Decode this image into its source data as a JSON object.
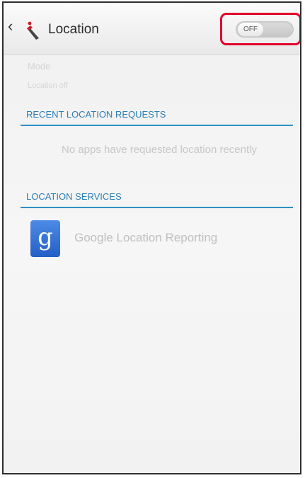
{
  "header": {
    "back_glyph": "‹",
    "title": "Location",
    "app_icon": "location-app-icon"
  },
  "toggle": {
    "label": "OFF",
    "state": "off",
    "highlight_color": "#e0002a"
  },
  "mode": {
    "title": "Mode",
    "value": "Location off"
  },
  "sections": {
    "recent_requests": {
      "header": "RECENT LOCATION REQUESTS",
      "empty_message": "No apps have requested location recently"
    },
    "location_services": {
      "header": "LOCATION SERVICES",
      "items": [
        {
          "label": "Google Location Reporting",
          "icon": "google-g-icon",
          "icon_letter": "g"
        }
      ]
    }
  },
  "colors": {
    "accent": "#2f8fc4",
    "section_text": "#2c7fb3",
    "disabled_text": "#c0c0c0"
  }
}
